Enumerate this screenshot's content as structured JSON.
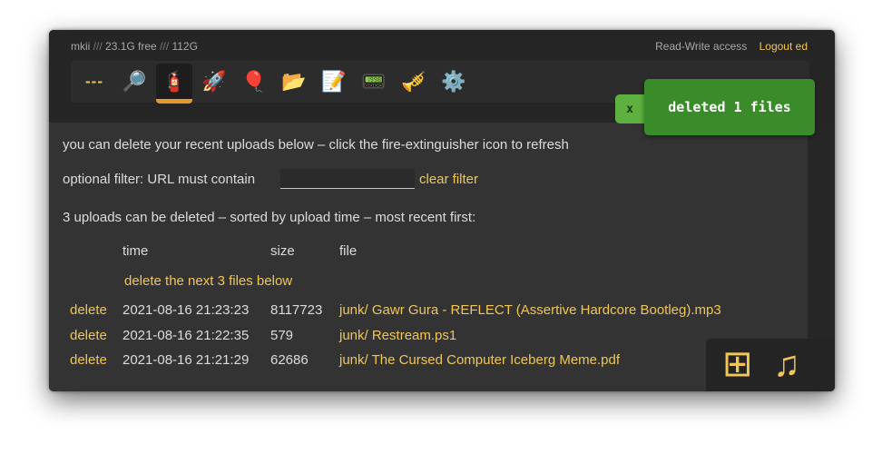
{
  "header": {
    "ops": {
      "hostname": "mkii",
      "separator": "///",
      "free": "23.1G free",
      "total": "112G"
    },
    "access": "Read-Write access",
    "logout": "Logout ed"
  },
  "toolbar": {
    "items": [
      {
        "name": "media-player",
        "label": "---"
      },
      {
        "name": "search",
        "glyph": "🔎"
      },
      {
        "name": "delete-uploads",
        "glyph": "🧯",
        "active": true
      },
      {
        "name": "upload",
        "glyph": "🚀"
      },
      {
        "name": "unpost-balloon",
        "glyph": "🎈"
      },
      {
        "name": "folder",
        "glyph": "📂"
      },
      {
        "name": "text-editor",
        "glyph": "📝"
      },
      {
        "name": "terminal",
        "glyph": "📟"
      },
      {
        "name": "bells",
        "glyph": "🎺"
      },
      {
        "name": "settings",
        "glyph": "⚙️"
      }
    ]
  },
  "toast": {
    "close": "x",
    "message": "deleted 1 files"
  },
  "main": {
    "intro": "you can delete your recent uploads below – click the fire-extinguisher icon to refresh",
    "filter_label": "optional filter:  URL must contain",
    "filter_value": "",
    "clear_filter": "clear filter",
    "summary": "3 uploads can be deleted – sorted by upload time – most recent first:",
    "columns": {
      "time": "time",
      "size": "size",
      "file": "file"
    },
    "delete_next": "delete the next 3 files below",
    "rows": [
      {
        "action": "delete",
        "time": "2021-08-16 21:23:23",
        "size": "8117723",
        "file": "junk/ Gawr Gura - REFLECT (Assertive Hardcore Bootleg).mp3"
      },
      {
        "action": "delete",
        "time": "2021-08-16 21:22:35",
        "size": "579",
        "file": "junk/ Restream.ps1"
      },
      {
        "action": "delete",
        "time": "2021-08-16 21:21:29",
        "size": "62686",
        "file": "junk/ The Cursed Computer Iceberg Meme.pdf"
      }
    ]
  },
  "corner": {
    "grid_glyph": "⊞",
    "music_glyph": "♫"
  },
  "colors": {
    "accent": "#f0c65a",
    "toast": "#3a8c2a",
    "active_tab": "#e79a2c"
  }
}
